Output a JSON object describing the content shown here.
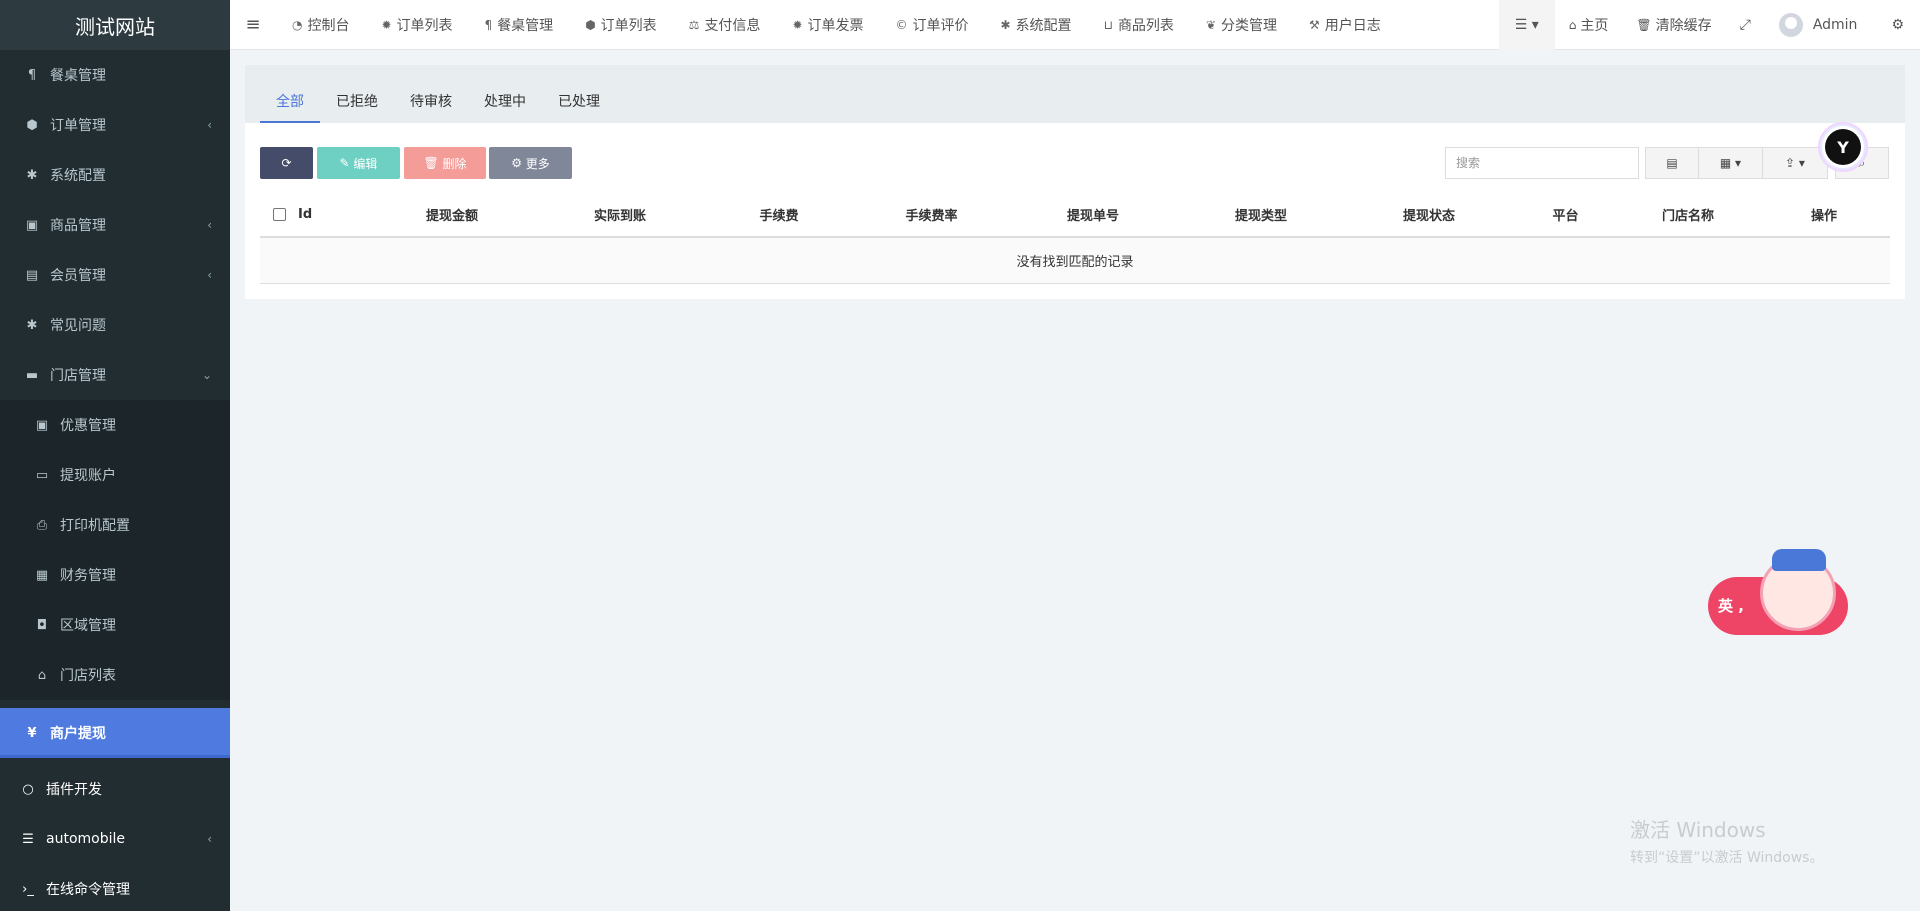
{
  "site": {
    "title": "测试网站"
  },
  "sidebar": {
    "items": [
      {
        "label": "餐桌管理",
        "icon": "utensils-icon"
      },
      {
        "label": "订单管理",
        "icon": "cube-icon",
        "caret": "‹"
      },
      {
        "label": "系统配置",
        "icon": "asterisk-icon"
      },
      {
        "label": "商品管理",
        "icon": "gift-icon",
        "caret": "‹"
      },
      {
        "label": "会员管理",
        "icon": "address-book-icon",
        "caret": "‹"
      },
      {
        "label": "常见问题",
        "icon": "asterisk-icon"
      },
      {
        "label": "门店管理",
        "icon": "archive-icon",
        "caret": "⌄"
      }
    ],
    "store_sub": [
      {
        "label": "优惠管理",
        "icon": "gift-icon"
      },
      {
        "label": "提现账户",
        "icon": "keyboard-icon"
      },
      {
        "label": "打印机配置",
        "icon": "print-icon"
      },
      {
        "label": "财务管理",
        "icon": "money-icon"
      },
      {
        "label": "区域管理",
        "icon": "square-icon"
      },
      {
        "label": "门店列表",
        "icon": "bank-icon"
      }
    ],
    "active": {
      "label": "商户提现",
      "icon_glyph": "¥"
    },
    "bottom": [
      {
        "label": "插件开发",
        "icon": "circle-icon"
      },
      {
        "label": "automobile",
        "icon": "list-icon",
        "caret": "‹"
      },
      {
        "label": "在线命令管理",
        "icon": "terminal-icon"
      }
    ]
  },
  "topnav": {
    "items": [
      {
        "label": "控制台",
        "icon": "dashboard-icon"
      },
      {
        "label": "订单列表",
        "icon": "gear-icon"
      },
      {
        "label": "餐桌管理",
        "icon": "utensils-icon"
      },
      {
        "label": "订单列表",
        "icon": "cube-icon"
      },
      {
        "label": "支付信息",
        "icon": "balance-scale-icon"
      },
      {
        "label": "订单发票",
        "icon": "gear-icon"
      },
      {
        "label": "订单评价",
        "icon": "copyright-icon"
      },
      {
        "label": "系统配置",
        "icon": "asterisk-icon"
      },
      {
        "label": "商品列表",
        "icon": "basket-icon"
      },
      {
        "label": "分类管理",
        "icon": "leaf-icon"
      },
      {
        "label": "用户日志",
        "icon": "gavel-icon"
      }
    ],
    "right": {
      "home": "主页",
      "clear_cache": "清除缓存",
      "user": "Admin"
    }
  },
  "panel": {
    "tabs": [
      "全部",
      "已拒绝",
      "待审核",
      "处理中",
      "已处理"
    ],
    "active_tab": "全部"
  },
  "toolbar": {
    "edit": "编辑",
    "delete": "删除",
    "more": "更多",
    "search_placeholder": "搜索"
  },
  "table": {
    "headers": [
      "Id",
      "提现金额",
      "实际到账",
      "手续费",
      "手续费率",
      "提现单号",
      "提现类型",
      "提现状态",
      "平台",
      "门店名称",
      "操作"
    ],
    "empty_text": "没有找到匹配的记录"
  },
  "mascot": {
    "text": "英 ,"
  },
  "watermark": {
    "line1": "激活 Windows",
    "line2": "转到“设置”以激活 Windows。"
  },
  "colors": {
    "sidebar_bg": "#222d32",
    "active_item": "#4f7be0",
    "tab_active": "#4b77d9",
    "btn_refresh": "#444c69",
    "btn_edit": "#6ed0c3",
    "btn_delete": "#f39c98",
    "btn_more": "#7f8799"
  }
}
